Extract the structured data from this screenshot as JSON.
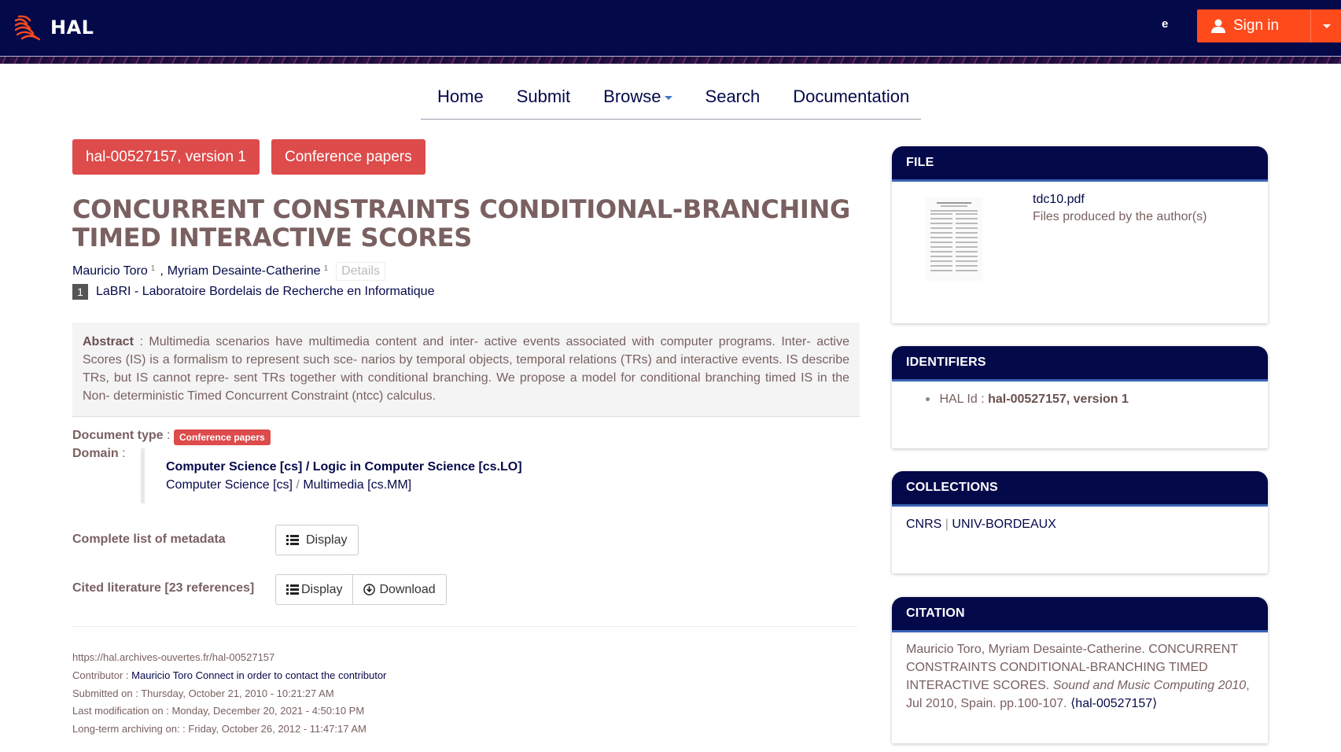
{
  "header": {
    "logo_text": "HAL",
    "language": "e",
    "signin_label": "Sign in"
  },
  "nav": {
    "items": [
      "Home",
      "Submit",
      "Browse",
      "Search",
      "Documentation"
    ]
  },
  "badges": {
    "id_version": "hal-00527157, version 1",
    "doc_type": "Conference papers"
  },
  "title": "CONCURRENT CONSTRAINTS CONDITIONAL-BRANCHING TIMED INTERACTIVE SCORES",
  "authors": [
    {
      "name": "Mauricio Toro",
      "aff": "1"
    },
    {
      "name": "Myriam Desainte-Catherine",
      "aff": "1"
    }
  ],
  "authors_sep": ",",
  "details_label": "Details",
  "affiliation": {
    "num": "1",
    "name": "LaBRI - Laboratoire Bordelais de Recherche en Informatique"
  },
  "abstract": {
    "label": "Abstract",
    "text": ": Multimedia scenarios have multimedia content and inter- active events associated with computer programs. Inter- active Scores (IS) is a formalism to represent such sce- narios by temporal objects, temporal relations (TRs) and interactive events. IS describe TRs, but IS cannot repre- sent TRs together with conditional branching. We propose a model for conditional branching timed IS in the Non- deterministic Timed Concurrent Constraint (ntcc) calculus."
  },
  "metadata": {
    "doc_type_label": "Document type",
    "doc_type_value": "Conference papers",
    "domain_label": "Domain",
    "domain_primary_1": "Computer Science [cs]",
    "domain_primary_2": "Logic in Computer Science [cs.LO]",
    "domain_secondary_1": "Computer Science [cs]",
    "domain_secondary_2": "Multimedia [cs.MM]",
    "separator": "/",
    "complete_list_label": "Complete list of metadata",
    "display_label": "Display",
    "cited_label": "Cited literature [23 references]",
    "download_label": "Download"
  },
  "footer": {
    "url": "https://hal.archives-ouvertes.fr/hal-00527157",
    "contributor_label": "Contributor :",
    "contributor_value": "Mauricio Toro Connect in order to contact the contributor",
    "submitted": "Submitted on : Thursday, October 21, 2010 - 10:21:27 AM",
    "modified": "Last modification on : Monday, December 20, 2021 - 4:50:10 PM",
    "archived": "Long-term archiving on: : Friday, October 26, 2012 - 11:47:17 AM"
  },
  "sidebar": {
    "file": {
      "title": "FILE",
      "filename": "tdc10.pdf",
      "description": "Files produced by the author(s)"
    },
    "identifiers": {
      "title": "IDENTIFIERS",
      "label": "HAL Id :",
      "value": "hal-00527157, version 1"
    },
    "collections": {
      "title": "COLLECTIONS",
      "items": [
        "CNRS",
        "UNIV-BORDEAUX"
      ],
      "separator": "|"
    },
    "citation": {
      "title": "CITATION",
      "text": "Mauricio Toro, Myriam Desainte-Catherine. CONCURRENT CONSTRAINTS CONDITIONAL-BRANCHING TIMED INTERACTIVE SCORES.",
      "venue": "Sound and Music Computing 2010",
      "rest": ", Jul 2010, Spain. pp.100-107.",
      "link": "⟨hal-00527157⟩"
    }
  },
  "colors": {
    "navy": "#04094a",
    "accent_orange": "#ff4a1c",
    "badge_red": "#dd4b4b",
    "text_brown": "#7a6060"
  }
}
